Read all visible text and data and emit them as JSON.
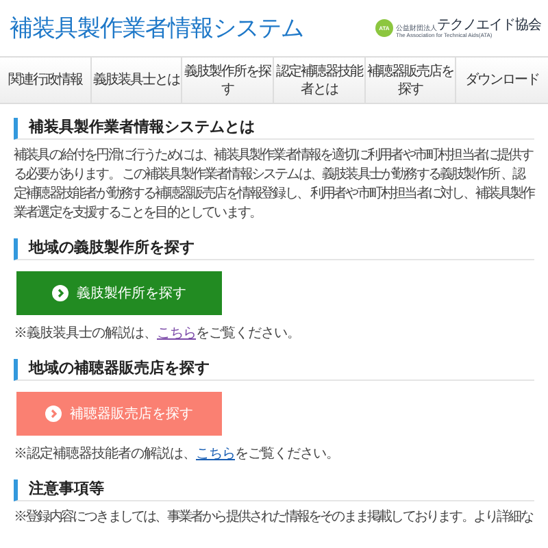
{
  "header": {
    "title": "補装具製作業者情報システム",
    "logo": {
      "badge": "ATA",
      "org": "公益財団法人",
      "name": "テクノエイド協会",
      "english": "The Association for Technical Aids(ATA)"
    }
  },
  "nav": [
    {
      "label": "関連行政情報"
    },
    {
      "label": "義肢装具士とは"
    },
    {
      "label": "義肢製作所を探す"
    },
    {
      "label": "認定補聴器技能者とは"
    },
    {
      "label": "補聴器販売店を探す"
    },
    {
      "label": "ダウンロード"
    }
  ],
  "sections": [
    {
      "heading": "補装具製作業者情報システムとは",
      "kind": "text",
      "text": "補装具の給付を円滑に行うためには、補装具製作業者情報を適切に利用者や市町村担当者に提供する必要があります。 この補装具製作業者情報システムは、義肢装具士が勤務する義肢製作所 、認定補聴器技能者が勤務する補聴器販売店を情報登録し、 利用者や市町村担当者に対し、補装具製作業者選定を支援することを目的としています。"
    },
    {
      "heading": "地域の義肢製作所を探す",
      "kind": "search",
      "button": {
        "label": "義肢製作所を探す",
        "color": "#228b22"
      },
      "note": {
        "before": "※義肢装具士の解説は、",
        "link": "こちら",
        "after": "をご覧ください。",
        "visited": true
      }
    },
    {
      "heading": "地域の補聴器販売店を探す",
      "kind": "search",
      "button": {
        "label": "補聴器販売店を探す",
        "color": "#fa8072"
      },
      "note": {
        "before": "※認定補聴器技能者の解説は、",
        "link": "こちら",
        "after": "をご覧ください。",
        "visited": false
      }
    },
    {
      "heading": "注意事項等",
      "kind": "text",
      "text": "※登録内容につきましては、事業者から提供された情報をそのまま掲載しております。より詳細な"
    }
  ]
}
